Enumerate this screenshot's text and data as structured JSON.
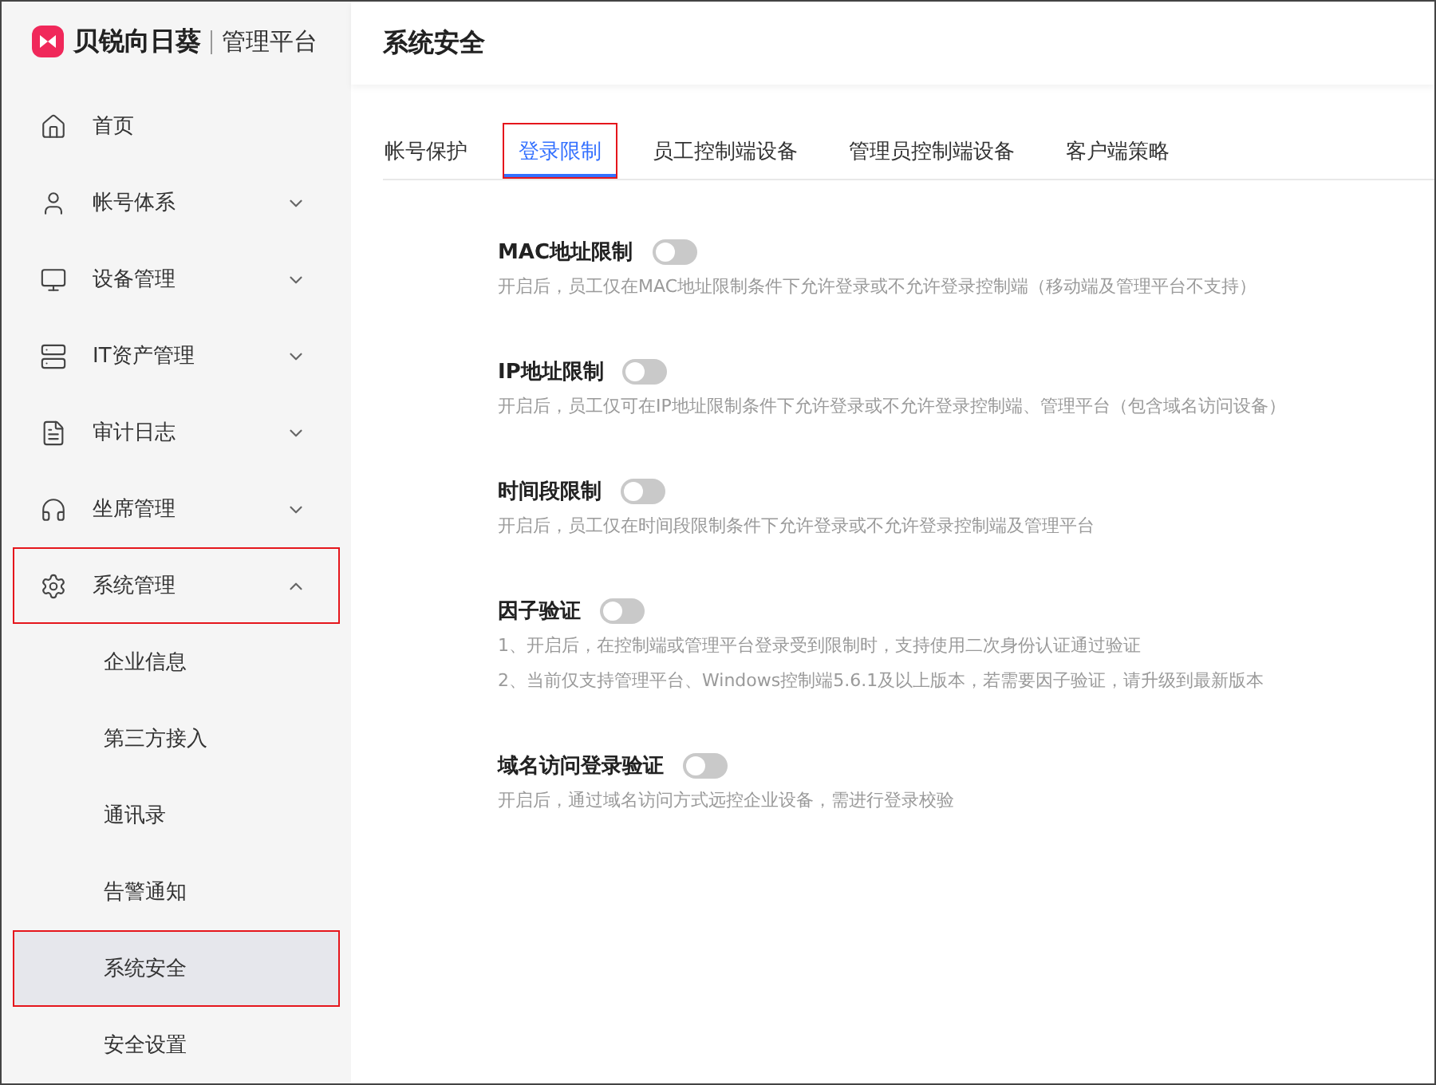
{
  "brand": {
    "name": "贝锐向日葵",
    "product": "管理平台"
  },
  "sidebar": {
    "items": [
      {
        "label": "首页",
        "highlighted": false
      },
      {
        "label": "帐号体系",
        "expanded": false,
        "highlighted": false
      },
      {
        "label": "设备管理",
        "expanded": false,
        "highlighted": false
      },
      {
        "label": "IT资产管理",
        "expanded": false,
        "highlighted": false
      },
      {
        "label": "审计日志",
        "expanded": false,
        "highlighted": false
      },
      {
        "label": "坐席管理",
        "expanded": false,
        "highlighted": false
      },
      {
        "label": "系统管理",
        "expanded": true,
        "highlighted": true,
        "children": [
          {
            "label": "企业信息",
            "selected": false,
            "highlighted": false
          },
          {
            "label": "第三方接入",
            "selected": false,
            "highlighted": false
          },
          {
            "label": "通讯录",
            "selected": false,
            "highlighted": false
          },
          {
            "label": "告警通知",
            "selected": false,
            "highlighted": false
          },
          {
            "label": "系统安全",
            "selected": true,
            "highlighted": true
          },
          {
            "label": "安全设置",
            "selected": false,
            "highlighted": false
          }
        ]
      }
    ]
  },
  "page_title": "系统安全",
  "tabs": [
    {
      "label": "帐号保护",
      "selected": false,
      "highlighted": false
    },
    {
      "label": "登录限制",
      "selected": true,
      "highlighted": true
    },
    {
      "label": "员工控制端设备",
      "selected": false,
      "highlighted": false
    },
    {
      "label": "管理员控制端设备",
      "selected": false,
      "highlighted": false
    },
    {
      "label": "客户端策略",
      "selected": false,
      "highlighted": false
    }
  ],
  "settings": [
    {
      "title": "MAC地址限制",
      "on": false,
      "descriptions": [
        "开启后，员工仅在MAC地址限制条件下允许登录或不允许登录控制端（移动端及管理平台不支持）"
      ]
    },
    {
      "title": "IP地址限制",
      "on": false,
      "descriptions": [
        "开启后，员工仅可在IP地址限制条件下允许登录或不允许登录控制端、管理平台（包含域名访问设备）"
      ]
    },
    {
      "title": "时间段限制",
      "on": false,
      "descriptions": [
        "开启后，员工仅在时间段限制条件下允许登录或不允许登录控制端及管理平台"
      ]
    },
    {
      "title": "因子验证",
      "on": false,
      "descriptions": [
        "1、开启后，在控制端或管理平台登录受到限制时，支持使用二次身份认证通过验证",
        "2、当前仅支持管理平台、Windows控制端5.6.1及以上版本，若需要因子验证，请升级到最新版本"
      ]
    },
    {
      "title": "域名访问登录验证",
      "on": false,
      "descriptions": [
        "开启后，通过域名访问方式远控企业设备，需进行登录校验"
      ]
    }
  ]
}
